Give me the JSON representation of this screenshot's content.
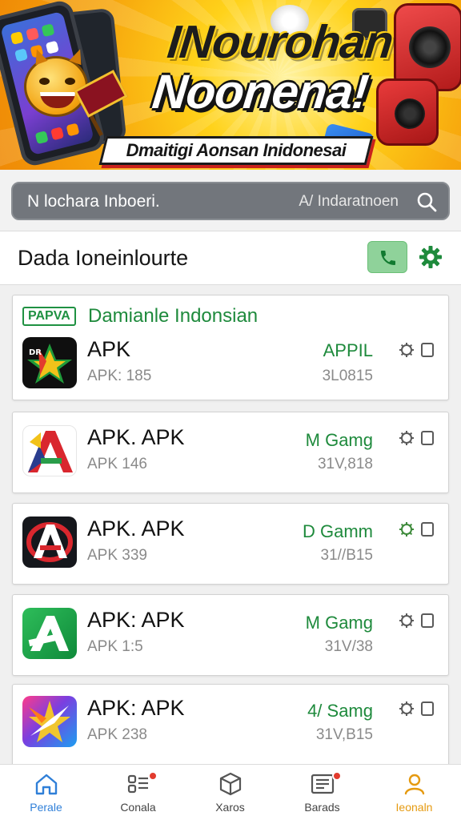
{
  "banner": {
    "title_line1": "INourohan",
    "title_line2": "Noonena!",
    "subtitle": "Dmaitigi Aonsan Inidonesai"
  },
  "search": {
    "left_text": "N lochara Inboeri.",
    "right_text": "A/ Indaratnoen"
  },
  "header": {
    "title": "Dada Ioneinlourte"
  },
  "featured": {
    "tag": "PAPVA",
    "title": "Damianle Indonsian"
  },
  "apps": [
    {
      "name": "APK",
      "sub": "APK: 185",
      "tag": "APPIL",
      "date": "3L0815",
      "icon_name": "dark-star-app-icon"
    },
    {
      "name": "APK. APK",
      "sub": "APK 146",
      "tag": "M Gamg",
      "date": "31V,818",
      "icon_name": "red-a-app-icon"
    },
    {
      "name": "APK. APK",
      "sub": "APK 339",
      "tag": "D Gamm",
      "date": "31//B15",
      "icon_name": "dark-a-app-icon"
    },
    {
      "name": "APK: APK",
      "sub": "APK 1:5",
      "tag": "M Gamg",
      "date": "31V/38",
      "icon_name": "green-a-app-icon"
    },
    {
      "name": "APK: APK",
      "sub": "APK 238",
      "tag": "4/ Samg",
      "date": "31V,B15",
      "icon_name": "colorful-star-app-icon"
    }
  ],
  "nav": [
    {
      "label": "Perale",
      "icon": "home-icon",
      "active": true
    },
    {
      "label": "Conala",
      "icon": "list-icon",
      "badge": true
    },
    {
      "label": "Xaros",
      "icon": "cube-icon"
    },
    {
      "label": "Barads",
      "icon": "news-icon",
      "badge": true
    },
    {
      "label": "Ieonaln",
      "icon": "profile-icon"
    }
  ],
  "colors": {
    "accent_green": "#1e8a3c",
    "banner_yellow": "#ffd21a",
    "nav_active": "#e59a10",
    "badge_red": "#e23b2e"
  }
}
